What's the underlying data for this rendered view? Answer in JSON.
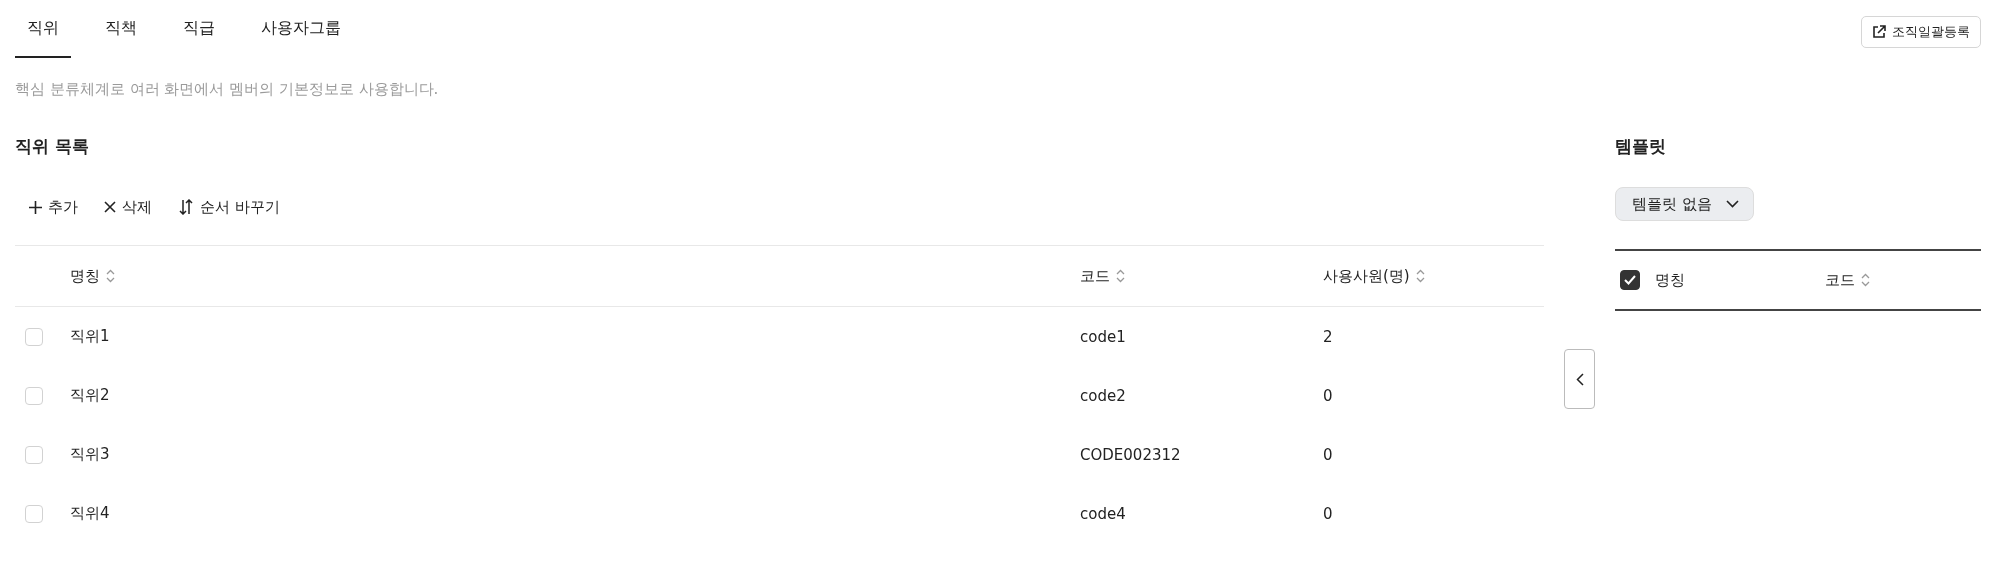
{
  "tabs": [
    {
      "label": "직위",
      "selected": true
    },
    {
      "label": "직책",
      "selected": false
    },
    {
      "label": "직급",
      "selected": false
    },
    {
      "label": "사용자그룹",
      "selected": false
    }
  ],
  "bulk_register_button": {
    "label": "조직일괄등록"
  },
  "description": "핵심 분류체계로 여러 화면에서 멤버의 기본정보로 사용합니다.",
  "list": {
    "title": "직위 목록",
    "toolbar": [
      {
        "kind": "add",
        "label": "추가"
      },
      {
        "kind": "delete",
        "label": "삭제"
      },
      {
        "kind": "reorder",
        "label": "순서 바꾸기"
      }
    ],
    "columns": [
      {
        "label": "명칭",
        "sortable": true
      },
      {
        "label": "코드",
        "sortable": true
      },
      {
        "label": "사용사원(명)",
        "sortable": true
      }
    ],
    "rows": [
      {
        "checked": false,
        "cells": [
          "직위1",
          "code1",
          "2"
        ]
      },
      {
        "checked": false,
        "cells": [
          "직위2",
          "code2",
          "0"
        ]
      },
      {
        "checked": false,
        "cells": [
          "직위3",
          "CODE002312",
          "0"
        ]
      },
      {
        "checked": false,
        "cells": [
          "직위4",
          "code4",
          "0"
        ]
      }
    ]
  },
  "template": {
    "title": "템플릿",
    "dropdown": {
      "value": "템플릿 없음"
    },
    "header_checked": true,
    "columns": [
      {
        "label": "명칭",
        "sortable": false
      },
      {
        "label": "코드",
        "sortable": true
      }
    ]
  }
}
